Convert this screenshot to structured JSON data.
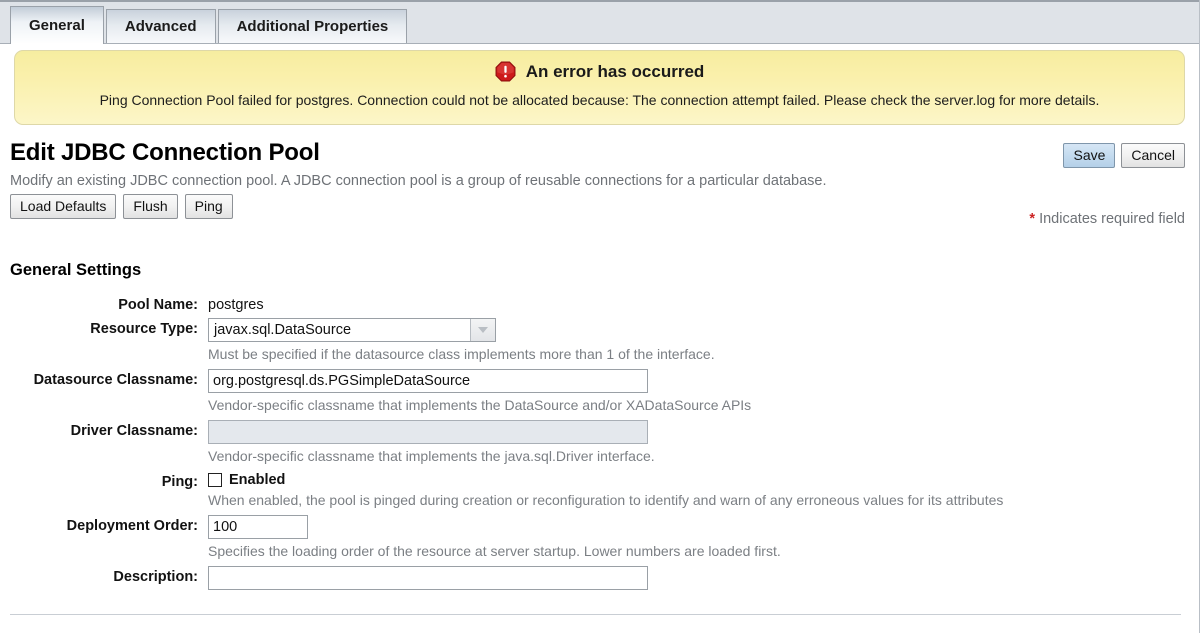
{
  "tabs": [
    {
      "label": "General",
      "active": true
    },
    {
      "label": "Advanced",
      "active": false
    },
    {
      "label": "Additional Properties",
      "active": false
    }
  ],
  "error_banner": {
    "icon": "error-octagon-icon",
    "title": "An error has occurred",
    "message": "Ping Connection Pool failed for postgres. Connection could not be allocated because: The connection attempt failed. Please check the server.log for more details.",
    "background_color": "#faf0ab",
    "border_color": "#ded8a8",
    "icon_color": "#cc1a1a"
  },
  "header": {
    "title": "Edit JDBC Connection Pool",
    "subtitle": "Modify an existing JDBC connection pool. A JDBC connection pool is a group of reusable connections for a particular database.",
    "actions": [
      {
        "label": "Load Defaults"
      },
      {
        "label": "Flush"
      },
      {
        "label": "Ping"
      }
    ],
    "save_label": "Save",
    "cancel_label": "Cancel",
    "required_star": "*",
    "required_note": "Indicates required field",
    "accent_color": "#c4dbef",
    "required_star_color": "#cc2222"
  },
  "section": {
    "title": "General Settings"
  },
  "fields": {
    "pool_name": {
      "label": "Pool Name:",
      "value": "postgres"
    },
    "resource_type": {
      "label": "Resource Type:",
      "value": "javax.sql.DataSource",
      "hint": "Must be specified if the datasource class implements more than 1 of the interface.",
      "options": [
        "javax.sql.DataSource"
      ]
    },
    "datasource_classname": {
      "label": "Datasource Classname:",
      "value": "org.postgresql.ds.PGSimpleDataSource",
      "placeholder": "",
      "hint": "Vendor-specific classname that implements the DataSource and/or XADataSource APIs"
    },
    "driver_classname": {
      "label": "Driver Classname:",
      "value": "",
      "placeholder": "",
      "hint": "Vendor-specific classname that implements the java.sql.Driver interface."
    },
    "ping": {
      "label": "Ping:",
      "checkbox_label": "Enabled",
      "checked": false,
      "hint": "When enabled, the pool is pinged during creation or reconfiguration to identify and warn of any erroneous values for its attributes"
    },
    "deployment_order": {
      "label": "Deployment Order:",
      "value": "100",
      "placeholder": "",
      "hint": "Specifies the loading order of the resource at server startup. Lower numbers are loaded first."
    },
    "description": {
      "label": "Description:",
      "value": "",
      "placeholder": ""
    }
  }
}
